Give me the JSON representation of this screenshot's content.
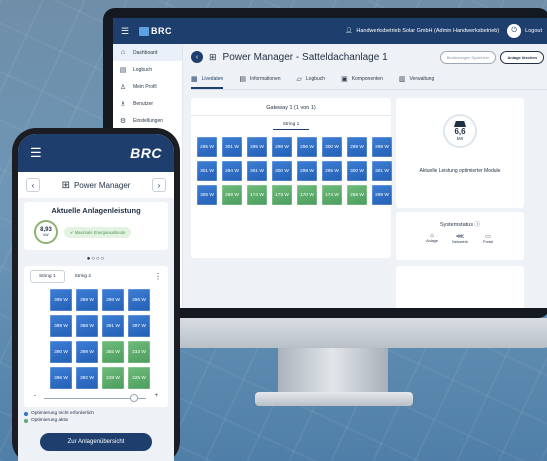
{
  "colors": {
    "brand_navy": "#1e3e6d",
    "module_blue": "#2f72c8",
    "module_green": "#5aac6a",
    "accent_green": "#8cb36f"
  },
  "desktop": {
    "brand": "BRC",
    "user_label": "Handwerksbetrieb Solar GmbH (Admin Handwerksbetrieb)",
    "logout_label": "Logout",
    "sidebar": [
      {
        "icon": "home-icon",
        "label": "Dashboard",
        "active": true
      },
      {
        "icon": "book-icon",
        "label": "Logbuch"
      },
      {
        "icon": "user-icon",
        "label": "Mein Profil"
      },
      {
        "icon": "users-icon",
        "label": "Benutzer"
      },
      {
        "icon": "gear-icon",
        "label": "Einstellungen"
      }
    ],
    "page_title": "Power Manager - Satteldachanlage 1",
    "buttons": {
      "secondary": "Bedienungen Speichern",
      "primary": "Anlage löschen"
    },
    "tabs": [
      {
        "label": "Livedaten",
        "active": true
      },
      {
        "label": "Informationen"
      },
      {
        "label": "Logbuch"
      },
      {
        "label": "Komponenten"
      },
      {
        "label": "Verwaltung"
      }
    ],
    "gateway_title": "Gateway 1 (1 von 1)",
    "string_tab": "String 1",
    "modules": [
      {
        "v": "295 W",
        "opt": false
      },
      {
        "v": "301 W",
        "opt": false
      },
      {
        "v": "295 W",
        "opt": false
      },
      {
        "v": "298 W",
        "opt": false
      },
      {
        "v": "296 W",
        "opt": false
      },
      {
        "v": "300 W",
        "opt": false
      },
      {
        "v": "299 W",
        "opt": false
      },
      {
        "v": "298 W",
        "opt": false
      },
      {
        "v": "301 W",
        "opt": false
      },
      {
        "v": "294 W",
        "opt": false
      },
      {
        "v": "301 W",
        "opt": false
      },
      {
        "v": "300 W",
        "opt": false
      },
      {
        "v": "298 W",
        "opt": false
      },
      {
        "v": "295 W",
        "opt": false
      },
      {
        "v": "300 W",
        "opt": false
      },
      {
        "v": "301 W",
        "opt": false
      },
      {
        "v": "305 W",
        "opt": false
      },
      {
        "v": "269 W",
        "opt": true
      },
      {
        "v": "174 W",
        "opt": true
      },
      {
        "v": "173 W",
        "opt": true
      },
      {
        "v": "170 W",
        "opt": true
      },
      {
        "v": "174 W",
        "opt": true
      },
      {
        "v": "258 W",
        "opt": true
      },
      {
        "v": "299 W",
        "opt": false
      }
    ],
    "live_power": {
      "value": "6,6",
      "unit": "kW",
      "label": "Aktuelle Leistung optimierter Module"
    },
    "systemstatus": {
      "title": "Systemstatus",
      "items": [
        {
          "label": "Anlage",
          "icon": "solar-icon"
        },
        {
          "label": "Netzwerk",
          "icon": "network-icon"
        },
        {
          "label": "Portal",
          "icon": "monitor-icon"
        }
      ]
    }
  },
  "mobile": {
    "brand": "BRC",
    "nav_title": "Power Manager",
    "card_title": "Aktuelle Anlagenleistung",
    "power": {
      "value": "8,93",
      "unit": "kW"
    },
    "badge": "Maximale Energieausbeute",
    "pager": "●○○○",
    "strings": [
      {
        "label": "String 1",
        "active": true
      },
      {
        "label": "String 2"
      }
    ],
    "modules": [
      {
        "v": "395 W",
        "opt": false
      },
      {
        "v": "389 W",
        "opt": false
      },
      {
        "v": "398 W",
        "opt": false
      },
      {
        "v": "396 W",
        "opt": false
      },
      {
        "v": "389 W",
        "opt": false
      },
      {
        "v": "388 W",
        "opt": false
      },
      {
        "v": "391 W",
        "opt": false
      },
      {
        "v": "397 W",
        "opt": false
      },
      {
        "v": "390 W",
        "opt": false
      },
      {
        "v": "398 W",
        "opt": false
      },
      {
        "v": "355 W",
        "opt": true
      },
      {
        "v": "233 W",
        "opt": true
      },
      {
        "v": "396 W",
        "opt": false
      },
      {
        "v": "392 W",
        "opt": false
      },
      {
        "v": "228 W",
        "opt": true
      },
      {
        "v": "225 W",
        "opt": true
      }
    ],
    "slider": {
      "min": "-",
      "max": "+",
      "level": 0.92
    },
    "legend": [
      {
        "label": "Optimierung nicht erforderlich",
        "color": "#2f72c8"
      },
      {
        "label": "Optimierung aktiv",
        "color": "#5aac6a"
      }
    ],
    "cta": "Zur Anlagenübersicht"
  }
}
